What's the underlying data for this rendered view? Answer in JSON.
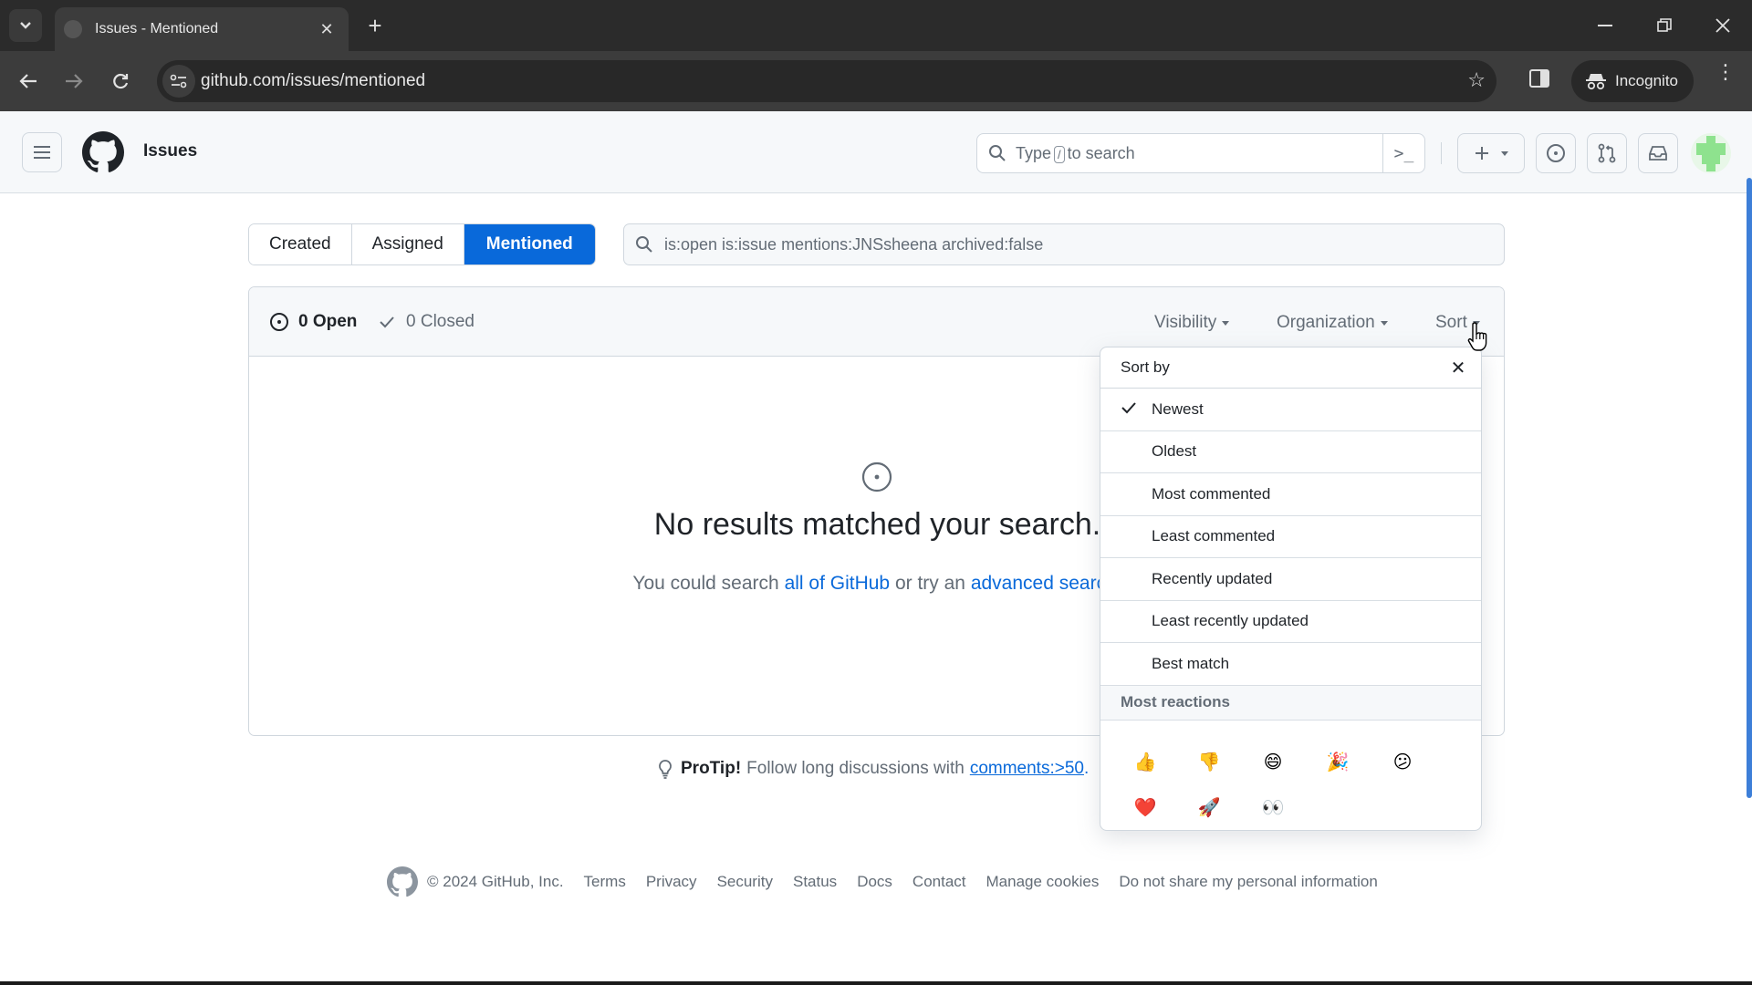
{
  "browser": {
    "tab_title": "Issues - Mentioned",
    "url": "github.com/issues/mentioned",
    "incognito_label": "Incognito",
    "icons": [
      "tab-list-icon",
      "github-favicon",
      "close-tab-icon",
      "new-tab-icon",
      "minimize-icon",
      "restore-icon",
      "close-window-icon",
      "back-icon",
      "forward-icon",
      "reload-icon",
      "site-info-icon",
      "bookmark-star-icon",
      "side-panel-icon",
      "incognito-icon",
      "more-menu-icon"
    ]
  },
  "header": {
    "context": "Issues",
    "search_placeholder_pre": "Type",
    "search_key": "/",
    "search_placeholder_post": "to search"
  },
  "tabs": [
    {
      "label": "Created",
      "active": false
    },
    {
      "label": "Assigned",
      "active": false
    },
    {
      "label": "Mentioned",
      "active": true
    }
  ],
  "filter": {
    "value": "is:open is:issue mentions:JNSsheena archived:false"
  },
  "issues_box": {
    "open_label": "0 Open",
    "closed_label": "0 Closed",
    "filters": [
      {
        "label": "Visibility"
      },
      {
        "label": "Organization"
      },
      {
        "label": "Sort"
      }
    ],
    "blank": {
      "title": "No results matched your search.",
      "sub_pre": "You could search ",
      "link1": "all of GitHub",
      "sub_mid": " or try an ",
      "link2": "advanced search",
      "sub_post": "."
    }
  },
  "sort_menu": {
    "title": "Sort by",
    "items": [
      {
        "label": "Newest",
        "selected": true
      },
      {
        "label": "Oldest",
        "selected": false
      },
      {
        "label": "Most commented",
        "selected": false
      },
      {
        "label": "Least commented",
        "selected": false
      },
      {
        "label": "Recently updated",
        "selected": false
      },
      {
        "label": "Least recently updated",
        "selected": false
      },
      {
        "label": "Best match",
        "selected": false
      }
    ],
    "reactions_title": "Most reactions",
    "reactions": [
      {
        "name": "thumbs-up",
        "glyph": "👍"
      },
      {
        "name": "thumbs-down",
        "glyph": "👎"
      },
      {
        "name": "laugh",
        "glyph": "😄"
      },
      {
        "name": "hooray",
        "glyph": "🎉"
      },
      {
        "name": "confused",
        "glyph": "😕"
      },
      {
        "name": "heart",
        "glyph": "❤️"
      },
      {
        "name": "rocket",
        "glyph": "🚀"
      },
      {
        "name": "eyes",
        "glyph": "👀"
      }
    ]
  },
  "protip": {
    "bold": "ProTip!",
    "text": "Follow long discussions with",
    "link": "comments:>50",
    "post": "."
  },
  "footer": {
    "copyright": "© 2024 GitHub, Inc.",
    "links": [
      "Terms",
      "Privacy",
      "Security",
      "Status",
      "Docs",
      "Contact",
      "Manage cookies",
      "Do not share my personal information"
    ]
  },
  "colors": {
    "accent": "#0969da",
    "muted": "#636c76",
    "border": "#d0d7de",
    "chrome_dark": "#2b2b2b",
    "chrome_toolbar": "#3c3c3c",
    "avatar_green": "#8ee28e"
  }
}
